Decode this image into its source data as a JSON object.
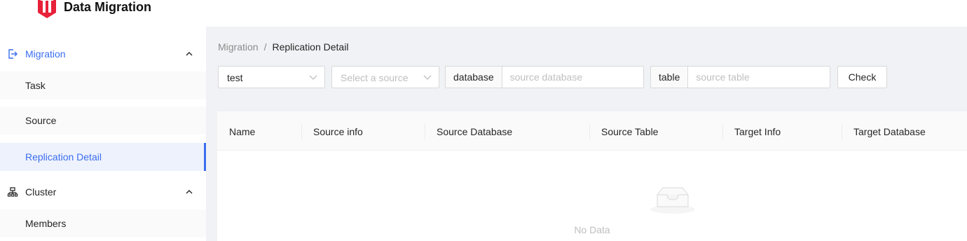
{
  "header": {
    "app_title": "Data Migration",
    "logo_icon": "data-migration-logo-icon"
  },
  "sidebar": {
    "groups": [
      {
        "label": "Migration",
        "icon": "login-arrow-icon",
        "expanded": true,
        "items": [
          {
            "label": "Task",
            "active": false
          },
          {
            "label": "Source",
            "active": false
          },
          {
            "label": "Replication Detail",
            "active": true
          }
        ]
      },
      {
        "label": "Cluster",
        "icon": "cluster-tree-icon",
        "expanded": true,
        "items": [
          {
            "label": "Members",
            "active": false
          }
        ]
      }
    ]
  },
  "breadcrumb": {
    "parent": "Migration",
    "separator": "/",
    "current": "Replication Detail"
  },
  "filters": {
    "task_select": {
      "value": "test"
    },
    "source_select": {
      "placeholder": "Select a source"
    },
    "database": {
      "addon": "database",
      "placeholder": "source database",
      "value": ""
    },
    "table": {
      "addon": "table",
      "placeholder": "source table",
      "value": ""
    },
    "check_button": "Check"
  },
  "table": {
    "columns": [
      "Name",
      "Source info",
      "Source Database",
      "Source Table",
      "Target Info",
      "Target Database"
    ],
    "rows": [],
    "empty_text": "No Data"
  },
  "colors": {
    "accent": "#3b6ef0",
    "brand_red": "#e8213a",
    "content_bg": "#f0f2f5"
  }
}
